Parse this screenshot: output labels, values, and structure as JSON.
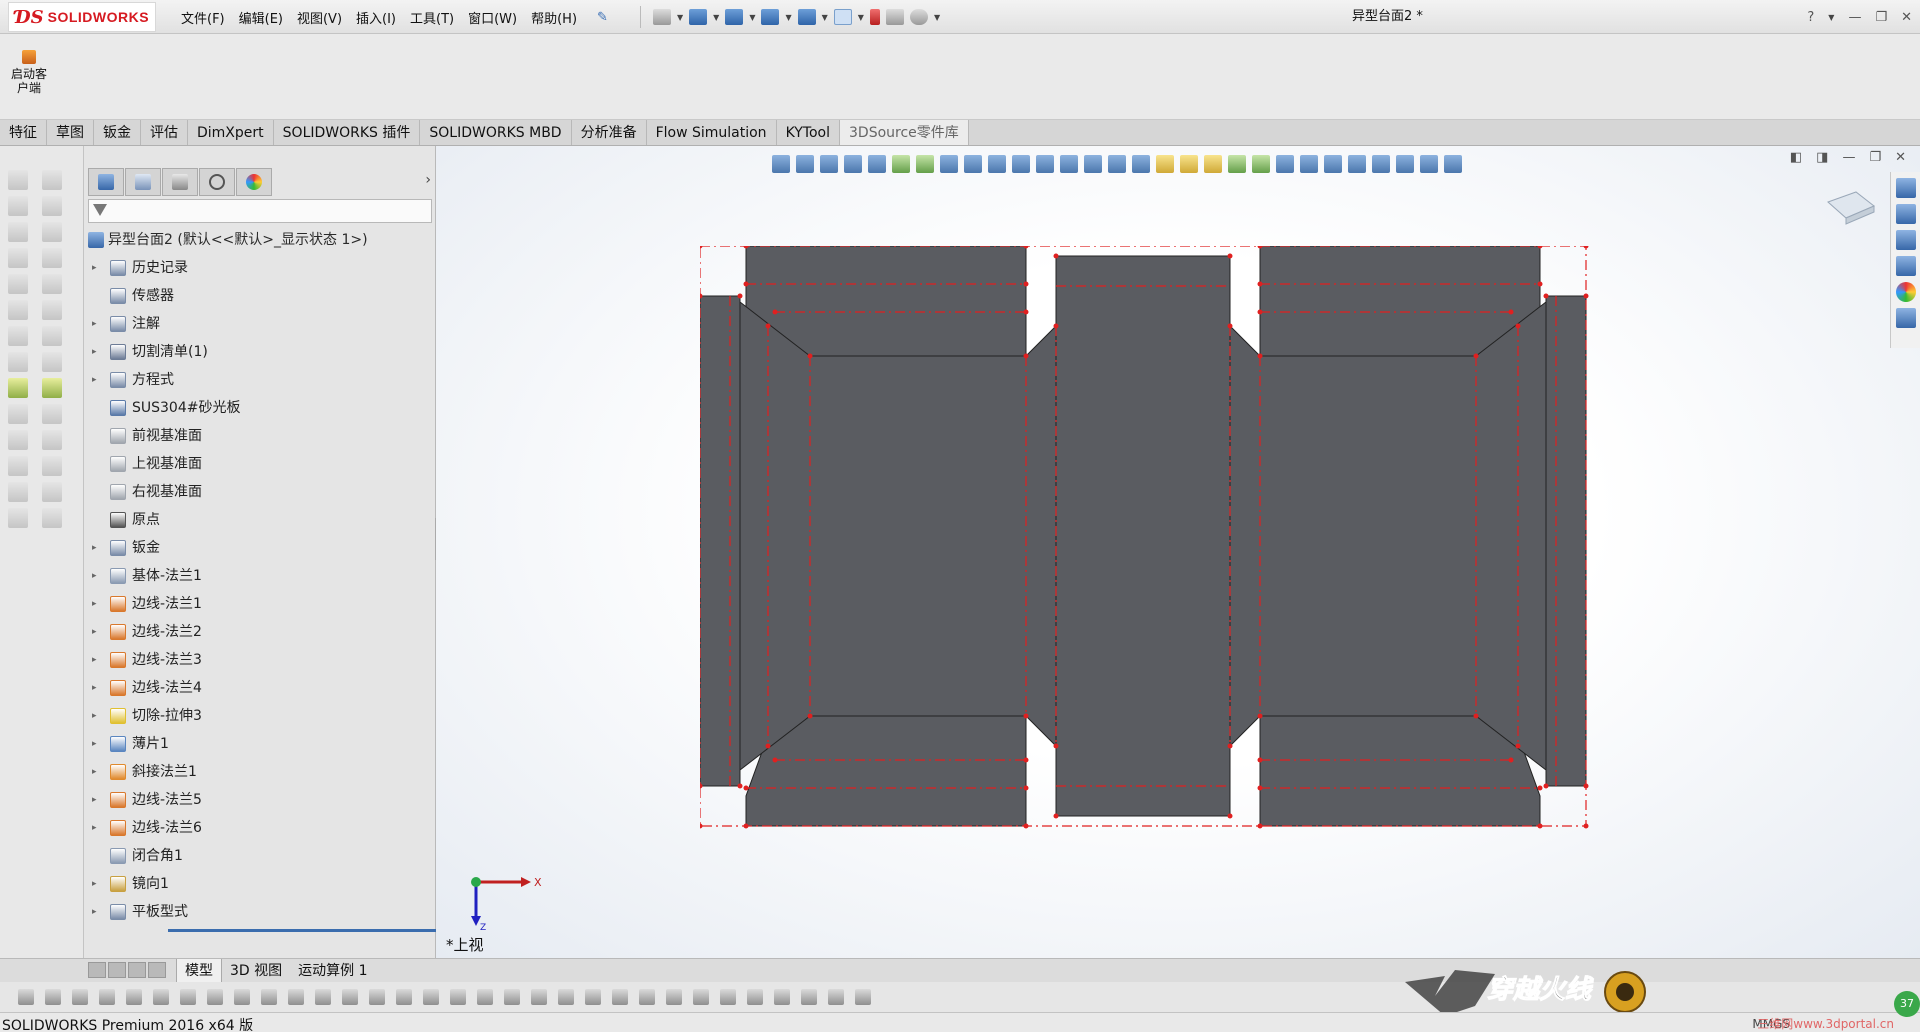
{
  "app": {
    "title": "SOLIDWORKS",
    "doc_title": "异型台面2 *"
  },
  "menu": [
    "文件(F)",
    "编辑(E)",
    "视图(V)",
    "插入(I)",
    "工具(T)",
    "窗口(W)",
    "帮助(H)"
  ],
  "ribbon": {
    "start_label": "启动客户端"
  },
  "tabs": [
    "特征",
    "草图",
    "钣金",
    "评估",
    "DimXpert",
    "SOLIDWORKS 插件",
    "SOLIDWORKS MBD",
    "分析准备",
    "Flow Simulation",
    "KYTool",
    "3DSource零件库"
  ],
  "active_tab": "3DSource零件库",
  "feature_tree": {
    "root": "异型台面2 (默认<<默认>_显示状态 1>)",
    "items": [
      {
        "label": "历史记录",
        "icon": "history-icon",
        "expand": true,
        "color": "#7a8ca8"
      },
      {
        "label": "传感器",
        "icon": "sensor-icon",
        "expand": false,
        "color": "#7a8ca8"
      },
      {
        "label": "注解",
        "icon": "annotation-icon",
        "expand": true,
        "color": "#7a8ca8"
      },
      {
        "label": "切割清单(1)",
        "icon": "cutlist-icon",
        "expand": true,
        "color": "#6d7c96"
      },
      {
        "label": "方程式",
        "icon": "equation-icon",
        "expand": true,
        "color": "#7a8ca8"
      },
      {
        "label": "SUS304#砂光板",
        "icon": "material-icon",
        "expand": false,
        "color": "#5a7aa8"
      },
      {
        "label": "前视基准面",
        "icon": "plane-icon",
        "expand": false,
        "color": "#a0a6ae"
      },
      {
        "label": "上视基准面",
        "icon": "plane-icon",
        "expand": false,
        "color": "#a0a6ae"
      },
      {
        "label": "右视基准面",
        "icon": "plane-icon",
        "expand": false,
        "color": "#a0a6ae"
      },
      {
        "label": "原点",
        "icon": "origin-icon",
        "expand": false,
        "color": "#555555"
      },
      {
        "label": "钣金",
        "icon": "sheetmetal-icon",
        "expand": true,
        "color": "#7a8ca8"
      },
      {
        "label": "基体-法兰1",
        "icon": "base-flange-icon",
        "expand": true,
        "color": "#8a9ab2"
      },
      {
        "label": "边线-法兰1",
        "icon": "edge-flange-icon",
        "expand": true,
        "color": "#d9782c"
      },
      {
        "label": "边线-法兰2",
        "icon": "edge-flange-icon",
        "expand": true,
        "color": "#d9782c"
      },
      {
        "label": "边线-法兰3",
        "icon": "edge-flange-icon",
        "expand": true,
        "color": "#d9782c"
      },
      {
        "label": "边线-法兰4",
        "icon": "edge-flange-icon",
        "expand": true,
        "color": "#d9782c"
      },
      {
        "label": "切除-拉伸3",
        "icon": "extrude-cut-icon",
        "expand": true,
        "color": "#e0c030"
      },
      {
        "label": "薄片1",
        "icon": "tab-icon",
        "expand": true,
        "color": "#5a86c0"
      },
      {
        "label": "斜接法兰1",
        "icon": "miter-flange-icon",
        "expand": true,
        "color": "#e08a2c"
      },
      {
        "label": "边线-法兰5",
        "icon": "edge-flange-icon",
        "expand": true,
        "color": "#d9782c"
      },
      {
        "label": "边线-法兰6",
        "icon": "edge-flange-icon",
        "expand": true,
        "color": "#d9782c"
      },
      {
        "label": "闭合角1",
        "icon": "closed-corner-icon",
        "expand": false,
        "color": "#8a9ab2"
      },
      {
        "label": "镜向1",
        "icon": "mirror-icon",
        "expand": true,
        "color": "#c8a040"
      },
      {
        "label": "平板型式",
        "icon": "flat-pattern-icon",
        "expand": true,
        "color": "#7a8ca8"
      }
    ]
  },
  "viewport": {
    "view_name": "*上视",
    "triad_x": "X",
    "triad_z": "Z"
  },
  "bottom_tabs": [
    "模型",
    "3D 视图",
    "运动算例 1"
  ],
  "active_bottom_tab": "模型",
  "status": {
    "text": "SOLIDWORKS Premium 2016 x64 版",
    "units": "MMGS",
    "watermark": "三维网www.3dportal.cn",
    "badge": "37"
  },
  "brand": "穿越火线",
  "colors": {
    "part_fill": "#5a5c61",
    "bend_line": "#e02020",
    "accent": "#3b6dae",
    "logo_red": "#d61a21"
  }
}
